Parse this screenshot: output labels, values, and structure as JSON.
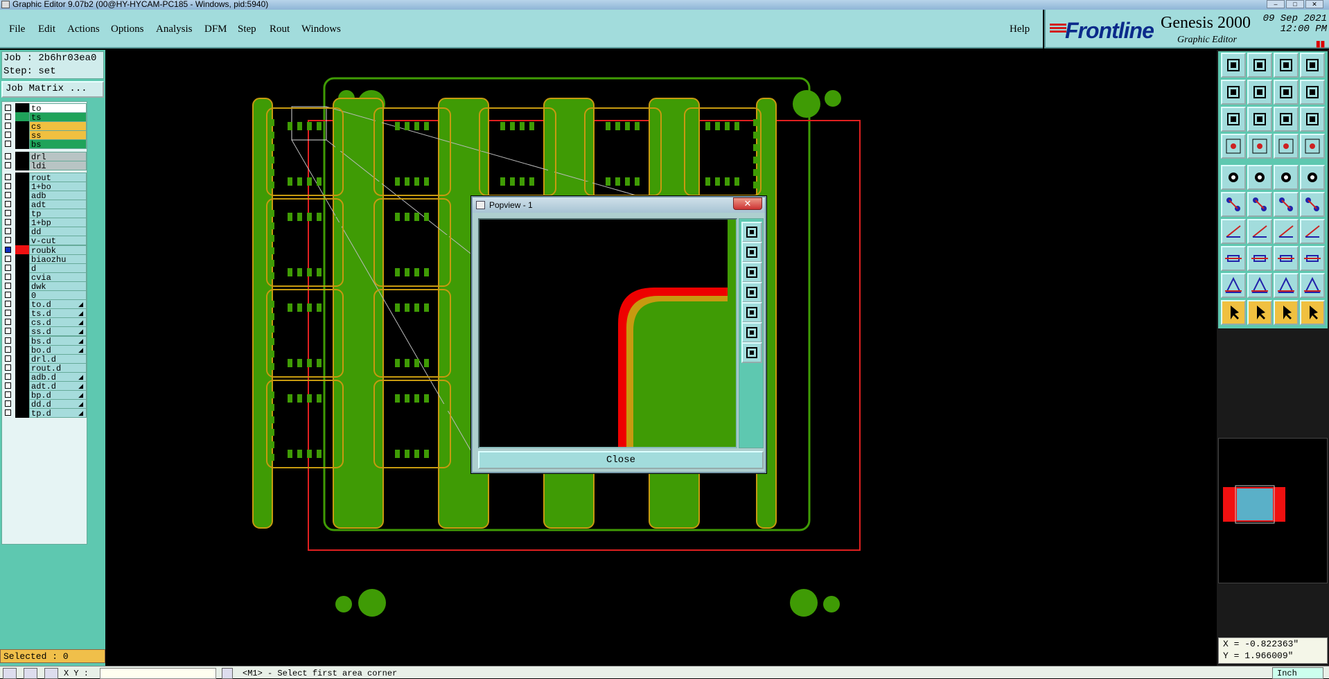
{
  "window": {
    "title": "Graphic Editor 9.07b2 (00@HY-HYCAM-PC185 - Windows, pid:5940)"
  },
  "menu": [
    "File",
    "Edit",
    "Actions",
    "Options",
    "Analysis",
    "DFM",
    "Step",
    "Rout",
    "Windows"
  ],
  "help_label": "Help",
  "brand": {
    "logo": "Frontline",
    "product": "Genesis 2000",
    "subtitle": "Graphic Editor",
    "date": "09 Sep 2021",
    "time": "12:00 PM"
  },
  "job": {
    "job_line": "Job : 2b6hr03ea0",
    "step_line": "Step: set",
    "matrix_button": "Job Matrix ..."
  },
  "layers": [
    {
      "name": "to",
      "color": "#ffffff"
    },
    {
      "name": "ts",
      "color": "#1fa35a"
    },
    {
      "name": "cs",
      "color": "#f0c040"
    },
    {
      "name": "ss",
      "color": "#f0c040"
    },
    {
      "name": "bs",
      "color": "#1fa35a"
    },
    {
      "name": "drl",
      "color": "#b8c4c4"
    },
    {
      "name": "ldi",
      "color": "#b8c4c4"
    },
    {
      "name": "rout",
      "color": "#a6dcdc"
    },
    {
      "name": "1+bo",
      "color": "#a6dcdc"
    },
    {
      "name": "adb",
      "color": "#a6dcdc"
    },
    {
      "name": "adt",
      "color": "#a6dcdc"
    },
    {
      "name": "tp",
      "color": "#a6dcdc"
    },
    {
      "name": "1+bp",
      "color": "#a6dcdc"
    },
    {
      "name": "dd",
      "color": "#a6dcdc"
    },
    {
      "name": "v-cut",
      "color": "#a6dcdc"
    },
    {
      "name": "roubk",
      "color": "#a6dcdc"
    },
    {
      "name": "biaozhu",
      "color": "#a6dcdc"
    },
    {
      "name": "d",
      "color": "#a6dcdc"
    },
    {
      "name": "cvia",
      "color": "#a6dcdc"
    },
    {
      "name": "dwk",
      "color": "#a6dcdc"
    },
    {
      "name": "0",
      "color": "#a6dcdc"
    },
    {
      "name": "to.d",
      "color": "#a6dcdc"
    },
    {
      "name": "ts.d",
      "color": "#a6dcdc"
    },
    {
      "name": "cs.d",
      "color": "#a6dcdc"
    },
    {
      "name": "ss.d",
      "color": "#a6dcdc"
    },
    {
      "name": "bs.d",
      "color": "#a6dcdc"
    },
    {
      "name": "bo.d",
      "color": "#a6dcdc"
    },
    {
      "name": "drl.d",
      "color": "#a6dcdc"
    },
    {
      "name": "rout.d",
      "color": "#a6dcdc"
    },
    {
      "name": "adb.d",
      "color": "#a6dcdc"
    },
    {
      "name": "adt.d",
      "color": "#a6dcdc"
    },
    {
      "name": "bp.d",
      "color": "#a6dcdc"
    },
    {
      "name": "dd.d",
      "color": "#a6dcdc"
    },
    {
      "name": "tp.d",
      "color": "#a6dcdc"
    }
  ],
  "selected_text": "Selected : 0",
  "popup": {
    "title": "Popview - 1",
    "close_label": "Close"
  },
  "coords": {
    "x": "X = -0.822363\"",
    "y": "Y = 1.966009\""
  },
  "status": {
    "xy_label": "X Y :",
    "prompt": "<M1> - Select first area corner",
    "units": "Inch"
  },
  "colors": {
    "board": "#3f9b05",
    "outline": "#c79a10",
    "profile": "#e02020",
    "panel_bg": "#a2dcdc"
  }
}
